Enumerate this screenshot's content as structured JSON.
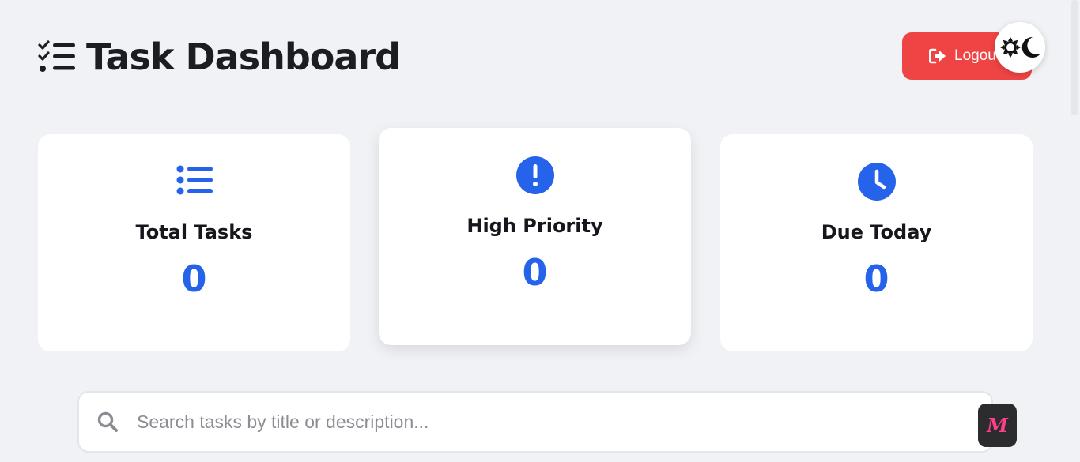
{
  "header": {
    "title": "Task Dashboard",
    "title_icon": "tasks-list-icon",
    "logout_label": "Logout",
    "logout_icon": "sign-out-icon",
    "theme_toggle_icons": [
      "sun-icon",
      "moon-icon"
    ]
  },
  "stats": [
    {
      "label": "Total Tasks",
      "value": "0",
      "icon": "list-icon"
    },
    {
      "label": "High Priority",
      "value": "0",
      "icon": "exclamation-circle-icon"
    },
    {
      "label": "Due Today",
      "value": "0",
      "icon": "clock-icon"
    }
  ],
  "search": {
    "placeholder": "Search tasks by title or description...",
    "value": "",
    "icon": "search-icon"
  },
  "badge": {
    "label": "M"
  },
  "colors": {
    "background": "#f0f2f6",
    "accent": "#2563eb",
    "danger": "#ef4444",
    "text": "#1c1d22",
    "badge_bg": "#2c2c2e",
    "badge_fg": "#ff3f8e"
  }
}
